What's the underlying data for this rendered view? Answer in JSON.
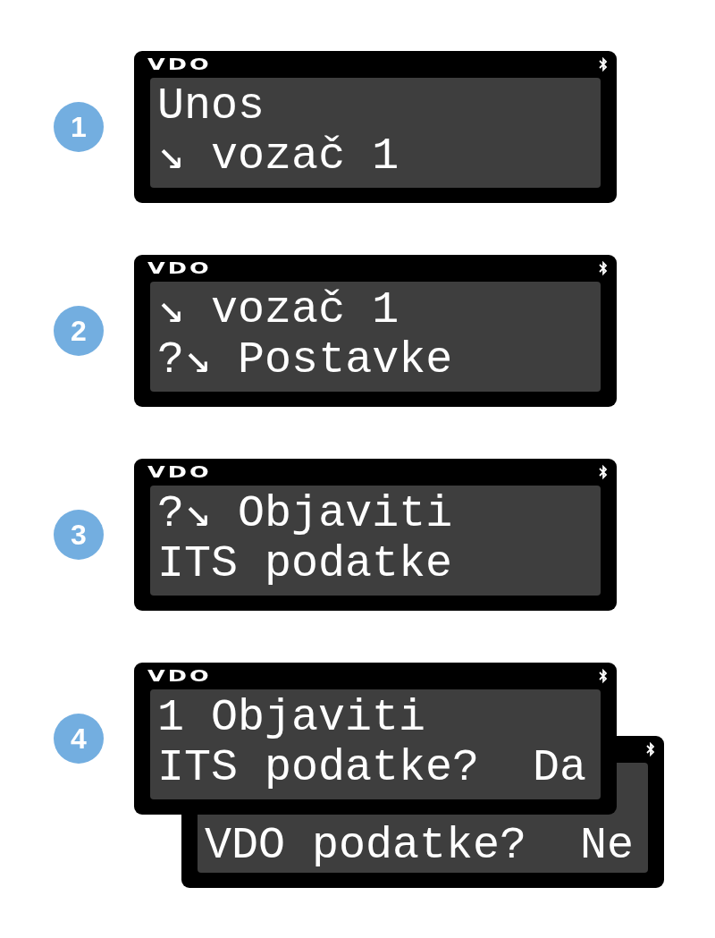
{
  "steps": [
    {
      "number": "1",
      "screens": [
        {
          "logo": "VDO",
          "lines": [
            "Unos",
            "↘ vozač 1"
          ]
        }
      ]
    },
    {
      "number": "2",
      "screens": [
        {
          "logo": "VDO",
          "lines": [
            "↘ vozač 1",
            "?↘ Postavke"
          ]
        }
      ]
    },
    {
      "number": "3",
      "screens": [
        {
          "logo": "VDO",
          "lines": [
            "?↘ Objaviti",
            "ITS podatke"
          ]
        }
      ]
    },
    {
      "number": "4",
      "screens": [
        {
          "logo": "VDO",
          "lines": [
            "1 Objaviti",
            "ITS podatke?  Da"
          ]
        },
        {
          "lines": [
            "VDO podatke?  Ne"
          ]
        }
      ]
    }
  ]
}
